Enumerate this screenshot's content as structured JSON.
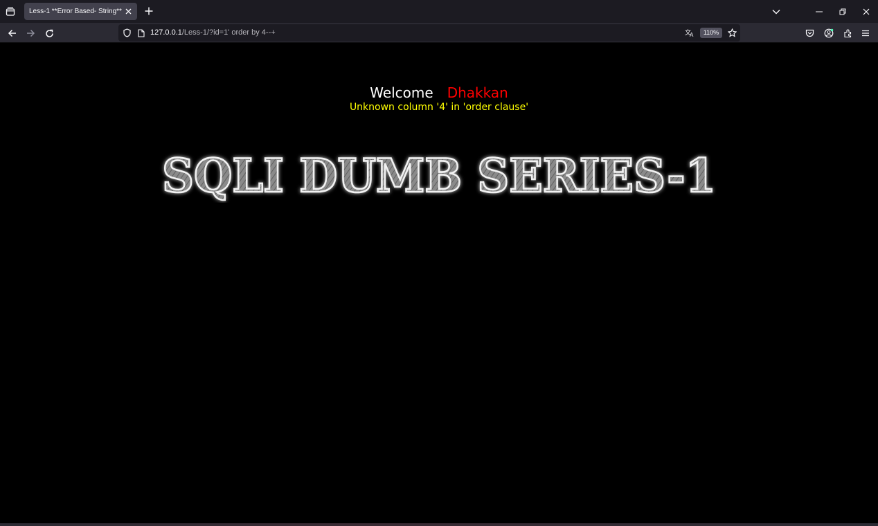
{
  "browser": {
    "tab": {
      "title": "Less-1 **Error Based- String**"
    },
    "url": {
      "host": "127.0.0.1",
      "path": "/Less-1/?id=1' order by 4--+"
    },
    "zoom": "110%"
  },
  "page": {
    "welcome_word": "Welcome",
    "welcome_name": "Dhakkan",
    "error_message": "Unknown column '4' in 'order clause'",
    "banner_text": "SQLI DUMB SERIES-1"
  },
  "colors": {
    "welcome": "#ffffff",
    "name": "#ff0000",
    "error": "#ffff00",
    "background": "#000000"
  }
}
